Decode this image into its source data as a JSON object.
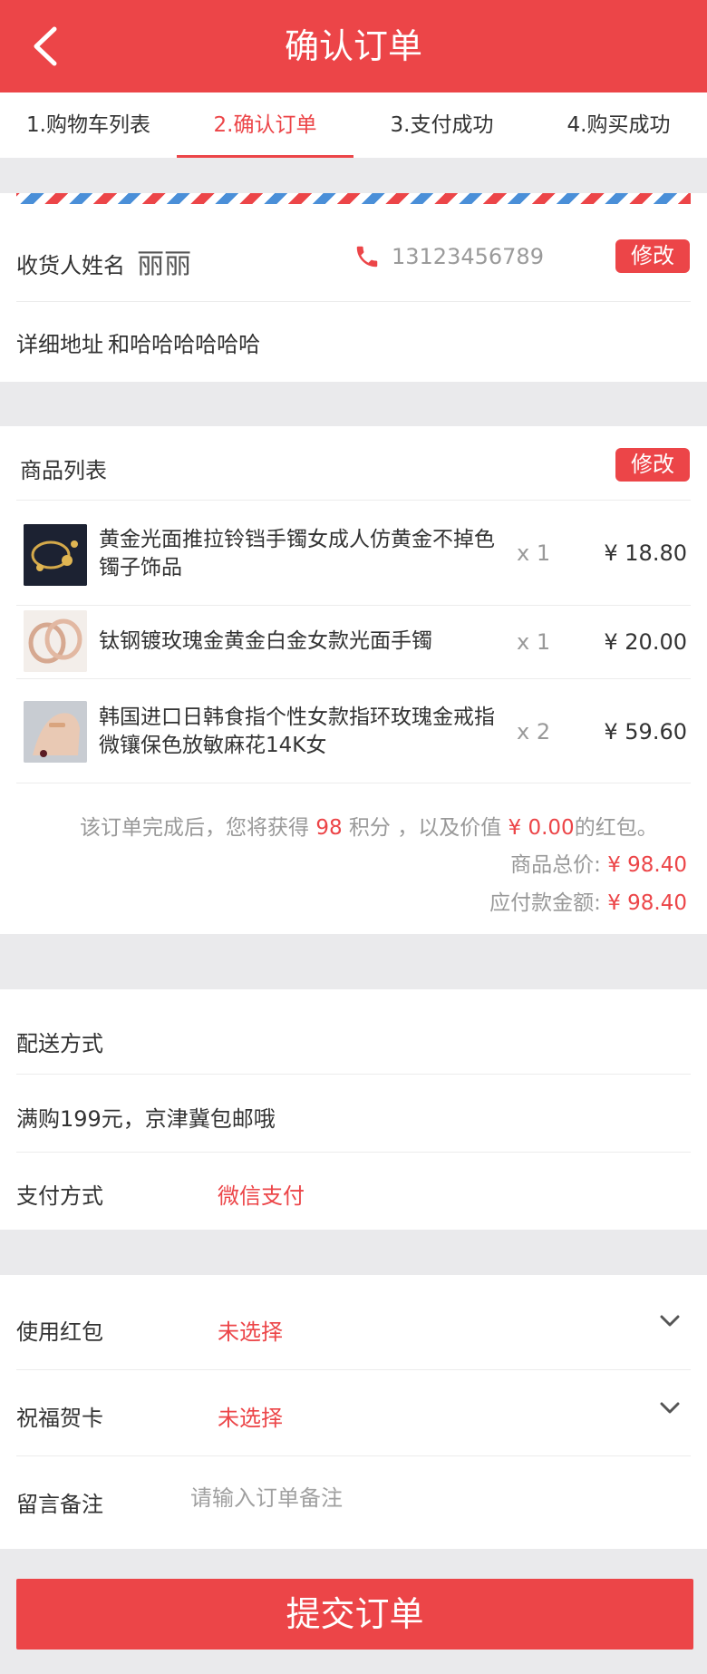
{
  "header": {
    "title": "确认订单"
  },
  "steps": [
    {
      "label": "1.购物车列表"
    },
    {
      "label": "2.确认订单"
    },
    {
      "label": "3.支付成功"
    },
    {
      "label": "4.购买成功"
    }
  ],
  "address": {
    "name_label": "收货人姓名",
    "name_value": "丽丽",
    "phone": "13123456789",
    "edit_label": "修改",
    "detail_label": "详细地址",
    "detail_value": "和哈哈哈哈哈哈"
  },
  "products": {
    "title": "商品列表",
    "edit_label": "修改",
    "items": [
      {
        "name": "黄金光面推拉铃铛手镯女成人仿黄金不掉色镯子饰品",
        "qty": "x 1",
        "price": "¥ 18.80",
        "thumb": "bracelet-bells-icon"
      },
      {
        "name": "钛钢镀玫瑰金黄金白金女款光面手镯",
        "qty": "x 1",
        "price": "¥ 20.00",
        "thumb": "rose-gold-bangle-icon"
      },
      {
        "name": "韩国进口日韩食指个性女款指环玫瑰金戒指微镶保色放敏麻花14K女",
        "qty": "x 2",
        "price": "¥ 59.60",
        "thumb": "ring-hand-icon"
      }
    ],
    "note_prefix": "该订单完成后，您将获得",
    "note_points": "98",
    "note_mid": "积分 ，以及价值",
    "note_amount": "¥ 0.00",
    "note_suffix": "的红包。",
    "total_label": "商品总价:",
    "total_value": "¥ 98.40",
    "pay_label": "应付款金额:",
    "pay_value": "¥ 98.40"
  },
  "delivery": {
    "label": "配送方式",
    "desc": "满购199元，京津冀包邮哦",
    "pay_method_label": "支付方式",
    "pay_method_value": "微信支付"
  },
  "options": {
    "redpacket_label": "使用红包",
    "redpacket_value": "未选择",
    "card_label": "祝福贺卡",
    "card_value": "未选择",
    "remark_label": "留言备注",
    "remark_placeholder": "请输入订单备注"
  },
  "submit_label": "提交订单",
  "colors": {
    "accent": "#ec4548",
    "airmail_blue": "#4a8fd8"
  }
}
